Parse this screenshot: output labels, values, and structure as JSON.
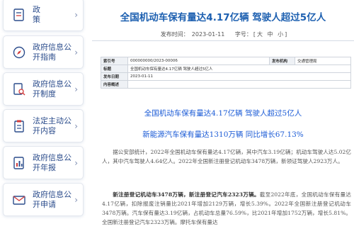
{
  "sidebar": {
    "items": [
      {
        "label": "政　策",
        "icon": "policy-icon"
      },
      {
        "label": "政府信息公开指南",
        "icon": "compass-icon"
      },
      {
        "label": "政府信息公开制度",
        "icon": "document-search-icon"
      },
      {
        "label": "法定主动公开内容",
        "icon": "clipboard-icon"
      },
      {
        "label": "政府信息公开年报",
        "icon": "report-icon"
      },
      {
        "label": "政府信息公开申请",
        "icon": "envelope-icon"
      }
    ]
  },
  "article": {
    "title": "全国机动车保有量达4.17亿辆 驾驶人超过5亿人",
    "date_label": "发布时间：",
    "date": "2023-01-11",
    "font_label": "字号：",
    "font_large": "大",
    "font_medium": "中",
    "font_small": "小",
    "table": {
      "index_label": "索引号",
      "index_value": "000000000/2023-00006",
      "publisher_label": "发布机构",
      "publisher_value": "交通管理局",
      "title_label": "标题",
      "title_value": "全国机动车保有量达4.17亿辆 驾驶人超过5亿人",
      "date_label": "发布日期",
      "date_value": "2023-01-11",
      "summary_label": "内容概述",
      "summary_value": ""
    },
    "heading1": "全国机动车保有量达4.17亿辆 驾驶人超过5亿人",
    "heading2": "新能源汽车保有量达1310万辆 同比增长67.13%",
    "paragraph1": "据公安部统计，2022年全国机动车保有量达4.17亿辆，其中汽车3.19亿辆；机动车驾驶人达5.02亿人，其中汽车驾驶人4.64亿人。2022年全国新注册登记机动车3478万辆，新领证驾驶人2923万人。",
    "paragraph2_bold": "新注册登记机动车3478万辆，新注册登记汽车2323万辆。",
    "paragraph2": "截至2022年底，全国机动车保有量达4.17亿辆，扣除报废注销量比2021年增加2129万辆，增长5.39%。2022年全国新注册登记机动车3478万辆。汽车保有量达3.19亿辆，占机动车总量76.59%，比2021年增加1752万辆，增长5.81%。全国新注册登记汽车2323万辆。摩托车保有量达"
  }
}
